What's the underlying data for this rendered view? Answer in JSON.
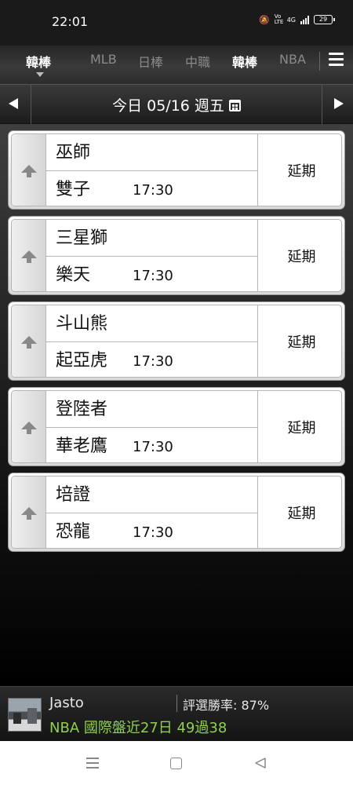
{
  "status_bar": {
    "time": "22:01",
    "network": "4G",
    "volte": "Vo LTE",
    "battery": "29"
  },
  "tabs": [
    {
      "label": "韓棒",
      "active": true
    },
    {
      "label": "MLB",
      "active": false
    },
    {
      "label": "日棒",
      "active": false
    },
    {
      "label": "中職",
      "active": false
    },
    {
      "label": "韓棒",
      "active": false
    },
    {
      "label": "NBA",
      "active": false
    }
  ],
  "date_bar": {
    "label": "今日 05/16 週五"
  },
  "games": [
    {
      "away": "巫師",
      "home": "雙子",
      "time": "17:30",
      "status": "延期"
    },
    {
      "away": "三星獅",
      "home": "樂天",
      "time": "17:30",
      "status": "延期"
    },
    {
      "away": "斗山熊",
      "home": "起亞虎",
      "time": "17:30",
      "status": "延期"
    },
    {
      "away": "登陸者",
      "home": "華老鷹",
      "time": "17:30",
      "status": "延期"
    },
    {
      "away": "培證",
      "home": "恐龍",
      "time": "17:30",
      "status": "延期"
    }
  ],
  "user": {
    "name": "Jasto",
    "win_rate": "評選勝率: 87%",
    "record": "NBA 國際盤近27日 49過38"
  },
  "colors": {
    "record_green": "#8fd14f",
    "tab_active": "#ffffff",
    "tab_inactive": "#8a8a8a"
  },
  "icons": {
    "menu": "hamburger-menu-icon",
    "prev": "left-arrow-icon",
    "next": "right-arrow-icon",
    "calendar": "calendar-icon",
    "card": "up-arrow-icon"
  }
}
